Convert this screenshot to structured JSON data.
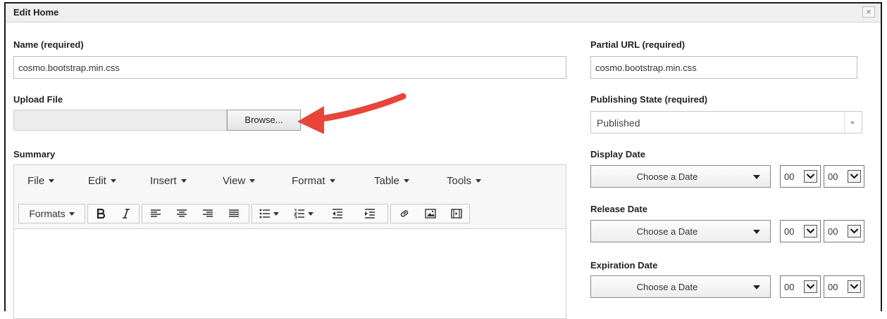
{
  "dialog": {
    "title": "Edit Home",
    "close_label": "×"
  },
  "name": {
    "label": "Name (required)",
    "value": "cosmo.bootstrap.min.css"
  },
  "upload": {
    "label": "Upload File",
    "browse_label": "Browse..."
  },
  "summary": {
    "label": "Summary",
    "menus": [
      "File",
      "Edit",
      "Insert",
      "View",
      "Format",
      "Table",
      "Tools"
    ],
    "formats_label": "Formats",
    "toolbar_icons": [
      "bold-icon",
      "italic-icon",
      "align-left-icon",
      "align-center-icon",
      "align-right-icon",
      "align-justify-icon",
      "bullet-list-icon",
      "numbered-list-icon",
      "outdent-icon",
      "indent-icon",
      "link-icon",
      "image-icon",
      "media-icon"
    ]
  },
  "partial_url": {
    "label": "Partial URL (required)",
    "value": "cosmo.bootstrap.min.css"
  },
  "publishing_state": {
    "label": "Publishing State (required)",
    "value": "Published"
  },
  "dates": {
    "display": {
      "label": "Display Date",
      "button": "Choose a Date",
      "hour": "00",
      "minute": "00"
    },
    "release": {
      "label": "Release Date",
      "button": "Choose a Date",
      "hour": "00",
      "minute": "00"
    },
    "expiration": {
      "label": "Expiration Date",
      "button": "Choose a Date",
      "hour": "00",
      "minute": "00"
    }
  },
  "colors": {
    "arrow": "#e8443a",
    "border": "#1a1a1a",
    "titlebar": "#efefef"
  }
}
